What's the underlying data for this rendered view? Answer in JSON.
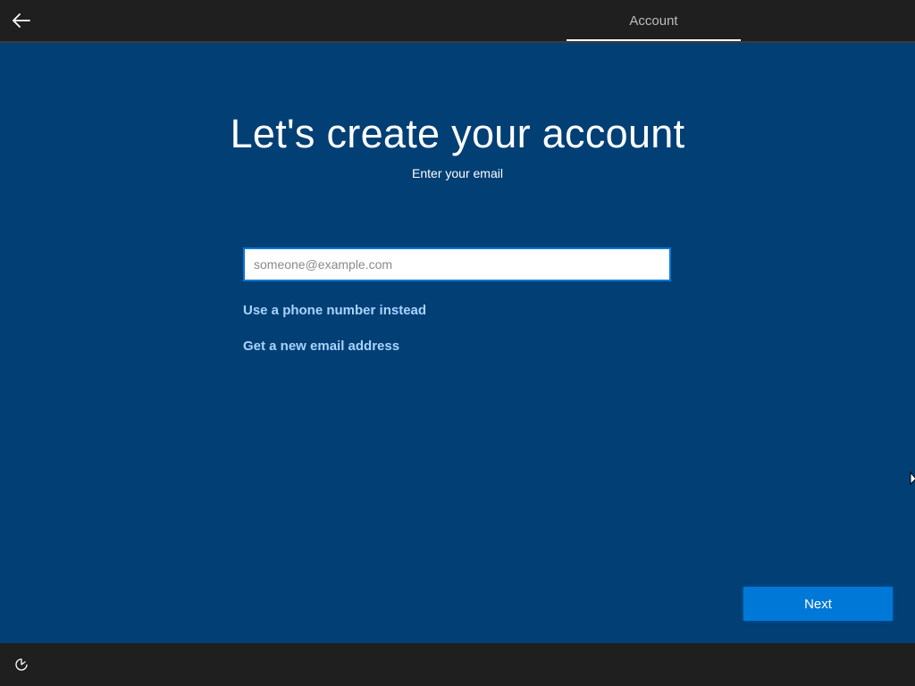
{
  "header": {
    "active_tab": "Account"
  },
  "main": {
    "title": "Let's create your account",
    "subtitle": "Enter your email",
    "email_input": {
      "value": "",
      "placeholder": "someone@example.com"
    },
    "links": {
      "phone": "Use a phone number instead",
      "new_email": "Get a new email address"
    },
    "next_label": "Next"
  },
  "icons": {
    "back": "back-arrow-icon",
    "ease_of_access": "ease-of-access-icon"
  },
  "colors": {
    "background": "#013f75",
    "bar": "#1f1f1f",
    "accent": "#0078d7",
    "link": "#a8d4ff"
  }
}
